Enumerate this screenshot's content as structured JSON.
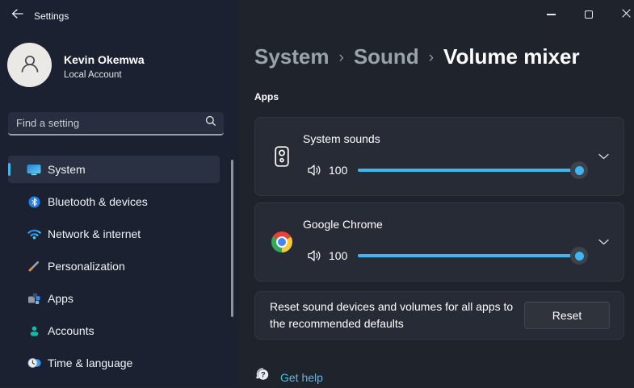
{
  "titlebar": {
    "title": "Settings"
  },
  "sidebar": {
    "user": {
      "name": "Kevin Okemwa",
      "account_type": "Local Account"
    },
    "search": {
      "placeholder": "Find a setting"
    },
    "nav": [
      {
        "label": "System",
        "icon": "system-icon",
        "selected": true
      },
      {
        "label": "Bluetooth & devices",
        "icon": "bluetooth-icon",
        "selected": false
      },
      {
        "label": "Network & internet",
        "icon": "network-icon",
        "selected": false
      },
      {
        "label": "Personalization",
        "icon": "personalization-icon",
        "selected": false
      },
      {
        "label": "Apps",
        "icon": "apps-icon",
        "selected": false
      },
      {
        "label": "Accounts",
        "icon": "accounts-icon",
        "selected": false
      },
      {
        "label": "Time & language",
        "icon": "time-language-icon",
        "selected": false
      }
    ]
  },
  "breadcrumb": {
    "separator": "›",
    "parts": [
      {
        "label": "System"
      },
      {
        "label": "Sound"
      },
      {
        "label": "Volume mixer"
      }
    ]
  },
  "content": {
    "section_label": "Apps",
    "mixers": [
      {
        "app": "System sounds",
        "icon": "system-sounds-icon",
        "volume": 100
      },
      {
        "app": "Google Chrome",
        "icon": "google-chrome-icon",
        "volume": 100
      }
    ],
    "reset": {
      "description": "Reset sound devices and volumes for all apps to the recommended defaults",
      "button_label": "Reset"
    },
    "help_link": "Get help"
  },
  "colors": {
    "accent": "#3db6f2",
    "link": "#5fb7e4",
    "sidebar_bg": "#1b2130",
    "content_bg": "#1f232c",
    "card_bg": "#262b35"
  }
}
